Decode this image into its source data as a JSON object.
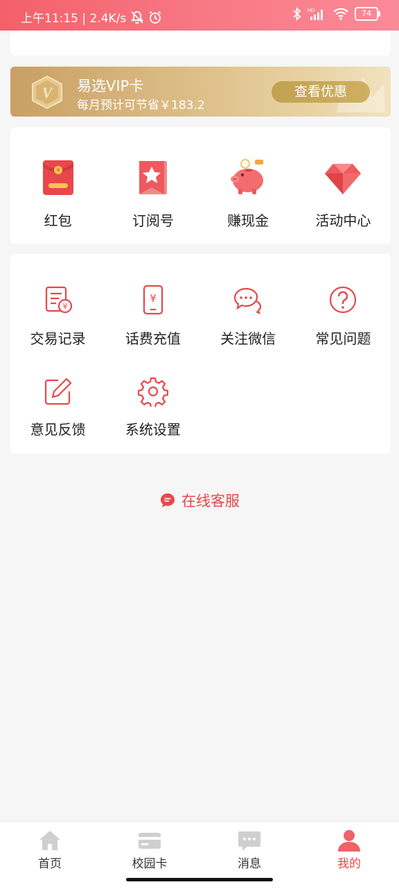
{
  "status_bar": {
    "time_speed": "上午11:15 | 2.4K/s",
    "battery": "74"
  },
  "vip": {
    "title": "易选VIP卡",
    "subtitle": "每月预计可节省￥183.2",
    "button": "查看优惠",
    "badge_letter": "V"
  },
  "promo": {
    "items": [
      {
        "label": "红包",
        "icon": "red-envelope-icon"
      },
      {
        "label": "订阅号",
        "icon": "star-bookmark-icon"
      },
      {
        "label": "赚现金",
        "icon": "piggy-bank-icon"
      },
      {
        "label": "活动中心",
        "icon": "diamond-icon"
      }
    ]
  },
  "services": {
    "items": [
      {
        "label": "交易记录",
        "icon": "transaction-record-icon"
      },
      {
        "label": "话费充值",
        "icon": "phone-recharge-icon"
      },
      {
        "label": "关注微信",
        "icon": "wechat-chat-icon"
      },
      {
        "label": "常见问题",
        "icon": "question-icon"
      },
      {
        "label": "意见反馈",
        "icon": "feedback-edit-icon"
      },
      {
        "label": "系统设置",
        "icon": "gear-icon"
      }
    ]
  },
  "online_service": {
    "label": "在线客服"
  },
  "bottom_nav": {
    "items": [
      {
        "label": "首页",
        "icon": "home-icon"
      },
      {
        "label": "校园卡",
        "icon": "card-icon"
      },
      {
        "label": "消息",
        "icon": "message-icon"
      },
      {
        "label": "我的",
        "icon": "person-icon"
      }
    ],
    "active_index": 3
  },
  "colors": {
    "accent": "#e9474a",
    "status_bar_start": "#f4606a",
    "status_bar_end": "#fb8a98",
    "vip_gold": "#c9a064",
    "icon_gray": "#c7c7c7"
  }
}
